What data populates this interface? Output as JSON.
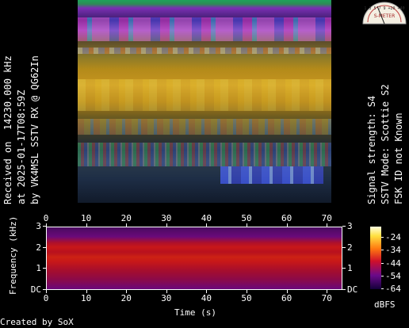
{
  "left_caption": {
    "line1": "Received on  14230.000 kHz",
    "line2": "at 2025-01-17T08:59Z",
    "line3": "by VK4MSL SSTV RX @ QG62In"
  },
  "right_caption": {
    "line1": "Signal strength: S4",
    "line2": "SSTV Mode: Scottie S2",
    "line3": "FSK ID not Known"
  },
  "meter": {
    "scale": "1 3 5 7 9 +20 +40",
    "label": "S-METER",
    "value_text": "S4"
  },
  "spectrogram": {
    "x_ticks": [
      "0",
      "10",
      "20",
      "30",
      "40",
      "50",
      "60",
      "70"
    ],
    "y_ticks": [
      "3",
      "2",
      "1",
      "DC"
    ],
    "x_label": "Time (s)",
    "y_label": "Frequency (kHz)",
    "colorbar_ticks": [
      "-24",
      "-34",
      "-44",
      "-54",
      "-64"
    ],
    "colorbar_label": "dBFS"
  },
  "footer": "Created by SoX"
}
